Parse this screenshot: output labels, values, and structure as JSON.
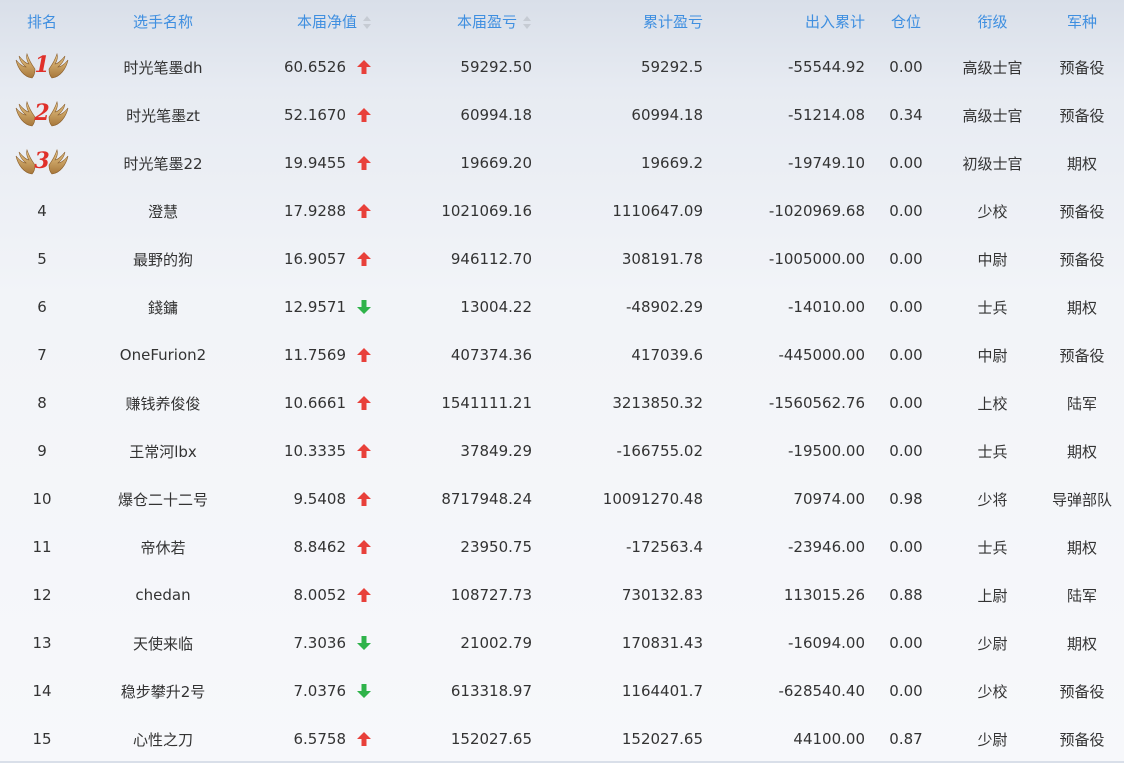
{
  "columns": {
    "rank": "排名",
    "name": "选手名称",
    "nav": "本届净值",
    "pnl": "本届盈亏",
    "cum": "累计盈亏",
    "flow": "出入累计",
    "pos": "仓位",
    "title": "衔级",
    "branch": "军种"
  },
  "colors": {
    "header_text": "#3f8fe0",
    "rank_medal": "#e0302a",
    "up_arrow": "#e8403a",
    "down_arrow": "#2fb34a"
  },
  "rows": [
    {
      "rank": "1",
      "name": "时光笔墨dh",
      "nav": "60.6526",
      "trend": "up",
      "pnl": "59292.50",
      "cum": "59292.5",
      "flow": "-55544.92",
      "pos": "0.00",
      "title": "高级士官",
      "branch": "预备役"
    },
    {
      "rank": "2",
      "name": "时光笔墨zt",
      "nav": "52.1670",
      "trend": "up",
      "pnl": "60994.18",
      "cum": "60994.18",
      "flow": "-51214.08",
      "pos": "0.34",
      "title": "高级士官",
      "branch": "预备役"
    },
    {
      "rank": "3",
      "name": "时光笔墨22",
      "nav": "19.9455",
      "trend": "up",
      "pnl": "19669.20",
      "cum": "19669.2",
      "flow": "-19749.10",
      "pos": "0.00",
      "title": "初级士官",
      "branch": "期权"
    },
    {
      "rank": "4",
      "name": "澄慧",
      "nav": "17.9288",
      "trend": "up",
      "pnl": "1021069.16",
      "cum": "1110647.09",
      "flow": "-1020969.68",
      "pos": "0.00",
      "title": "少校",
      "branch": "预备役"
    },
    {
      "rank": "5",
      "name": "最野的狗",
      "nav": "16.9057",
      "trend": "up",
      "pnl": "946112.70",
      "cum": "308191.78",
      "flow": "-1005000.00",
      "pos": "0.00",
      "title": "中尉",
      "branch": "预备役"
    },
    {
      "rank": "6",
      "name": "錢鏞",
      "nav": "12.9571",
      "trend": "down",
      "pnl": "13004.22",
      "cum": "-48902.29",
      "flow": "-14010.00",
      "pos": "0.00",
      "title": "士兵",
      "branch": "期权"
    },
    {
      "rank": "7",
      "name": "OneFurion2",
      "nav": "11.7569",
      "trend": "up",
      "pnl": "407374.36",
      "cum": "417039.6",
      "flow": "-445000.00",
      "pos": "0.00",
      "title": "中尉",
      "branch": "预备役"
    },
    {
      "rank": "8",
      "name": "赚钱养俊俊",
      "nav": "10.6661",
      "trend": "up",
      "pnl": "1541111.21",
      "cum": "3213850.32",
      "flow": "-1560562.76",
      "pos": "0.00",
      "title": "上校",
      "branch": "陆军"
    },
    {
      "rank": "9",
      "name": "王常河lbx",
      "nav": "10.3335",
      "trend": "up",
      "pnl": "37849.29",
      "cum": "-166755.02",
      "flow": "-19500.00",
      "pos": "0.00",
      "title": "士兵",
      "branch": "期权"
    },
    {
      "rank": "10",
      "name": "爆仓二十二号",
      "nav": "9.5408",
      "trend": "up",
      "pnl": "8717948.24",
      "cum": "10091270.48",
      "flow": "70974.00",
      "pos": "0.98",
      "title": "少将",
      "branch": "导弹部队"
    },
    {
      "rank": "11",
      "name": "帝休若",
      "nav": "8.8462",
      "trend": "up",
      "pnl": "23950.75",
      "cum": "-172563.4",
      "flow": "-23946.00",
      "pos": "0.00",
      "title": "士兵",
      "branch": "期权"
    },
    {
      "rank": "12",
      "name": "chedan",
      "nav": "8.0052",
      "trend": "up",
      "pnl": "108727.73",
      "cum": "730132.83",
      "flow": "113015.26",
      "pos": "0.88",
      "title": "上尉",
      "branch": "陆军"
    },
    {
      "rank": "13",
      "name": "天使来临",
      "nav": "7.3036",
      "trend": "down",
      "pnl": "21002.79",
      "cum": "170831.43",
      "flow": "-16094.00",
      "pos": "0.00",
      "title": "少尉",
      "branch": "期权"
    },
    {
      "rank": "14",
      "name": "稳步攀升2号",
      "nav": "7.0376",
      "trend": "down",
      "pnl": "613318.97",
      "cum": "1164401.7",
      "flow": "-628540.40",
      "pos": "0.00",
      "title": "少校",
      "branch": "预备役"
    },
    {
      "rank": "15",
      "name": "心性之刀",
      "nav": "6.5758",
      "trend": "up",
      "pnl": "152027.65",
      "cum": "152027.65",
      "flow": "44100.00",
      "pos": "0.87",
      "title": "少尉",
      "branch": "预备役"
    }
  ]
}
